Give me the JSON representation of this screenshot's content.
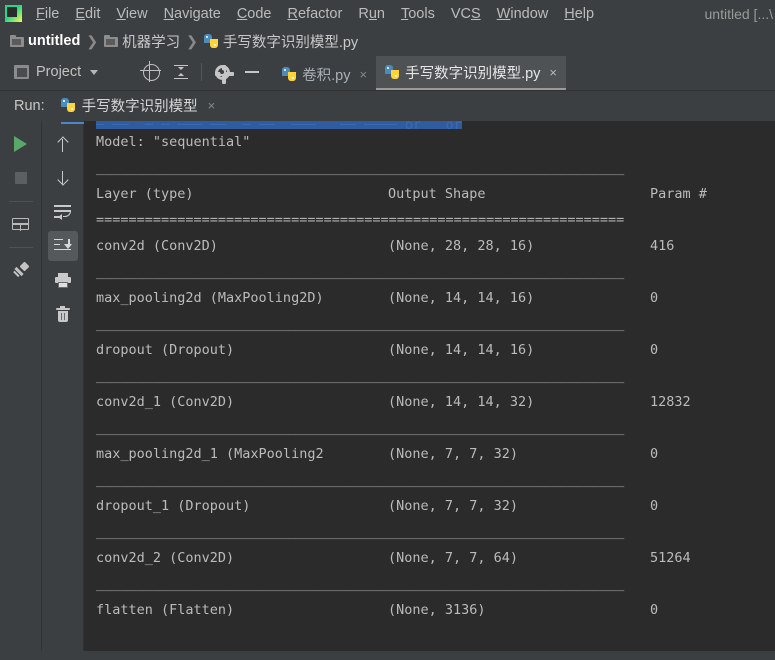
{
  "window": {
    "title": "untitled [...\\"
  },
  "menubar": {
    "items": [
      {
        "label": "File",
        "mnemonic": "F"
      },
      {
        "label": "Edit",
        "mnemonic": "E"
      },
      {
        "label": "View",
        "mnemonic": "V"
      },
      {
        "label": "Navigate",
        "mnemonic": "N"
      },
      {
        "label": "Code",
        "mnemonic": "C"
      },
      {
        "label": "Refactor",
        "mnemonic": "R"
      },
      {
        "label": "Run",
        "mnemonic": "u"
      },
      {
        "label": "Tools",
        "mnemonic": "T"
      },
      {
        "label": "VCS",
        "mnemonic": "S"
      },
      {
        "label": "Window",
        "mnemonic": "W"
      },
      {
        "label": "Help",
        "mnemonic": "H"
      }
    ]
  },
  "breadcrumb": {
    "root": "untitled",
    "folder": "机器学习",
    "file": "手写数字识别模型.py",
    "separator": "❯"
  },
  "toolbar": {
    "project_label": "Project",
    "buttons": [
      {
        "name": "locate-icon",
        "title": "Select Opened File"
      },
      {
        "name": "collapse-all-icon",
        "title": "Collapse All"
      },
      {
        "name": "gear-icon",
        "title": "Settings"
      },
      {
        "name": "minimize-icon",
        "title": "Hide"
      }
    ]
  },
  "editor_tabs": [
    {
      "label": "卷积.py",
      "active": false,
      "close": "×"
    },
    {
      "label": "手写数字识别模型.py",
      "active": true,
      "close": "×"
    }
  ],
  "run_panel": {
    "label": "Run:",
    "config_name": "手写数字识别模型",
    "close": "×",
    "left_buttons": [
      {
        "name": "rerun-button",
        "icon": "run-icon"
      },
      {
        "name": "stop-button",
        "icon": "stop-icon"
      },
      {
        "name": "restore-layout-button",
        "icon": "layout-icon"
      },
      {
        "name": "pin-tab-button",
        "icon": "pin-icon"
      }
    ],
    "right_buttons": [
      {
        "name": "up-the-stack-trace-button",
        "icon": "arrow-up-icon"
      },
      {
        "name": "down-the-stack-trace-button",
        "icon": "arrow-down-icon"
      },
      {
        "name": "soft-wrap-button",
        "icon": "soft-wrap-icon",
        "active": false
      },
      {
        "name": "scroll-to-end-button",
        "icon": "scroll-to-end-icon",
        "active": true
      },
      {
        "name": "print-button",
        "icon": "print-icon"
      },
      {
        "name": "clear-all-button",
        "icon": "trash-icon"
      }
    ]
  },
  "console": {
    "clipped_top_line": "─ ──  ─ ─ ─── ──  ─ ──  ───   ── ──── or   or",
    "model_title": "Model: \"sequential\"",
    "dash_rule": "_________________________________________________________________",
    "equals_rule": "=================================================================",
    "headers": {
      "layer": "Layer (type)",
      "shape": "Output Shape",
      "param": "Param #"
    },
    "rows": [
      {
        "layer": "conv2d (Conv2D)",
        "shape": "(None, 28, 28, 16)",
        "param": "416"
      },
      {
        "layer": "max_pooling2d (MaxPooling2D)",
        "shape": "(None, 14, 14, 16)",
        "param": "0"
      },
      {
        "layer": "dropout (Dropout)",
        "shape": "(None, 14, 14, 16)",
        "param": "0"
      },
      {
        "layer": "conv2d_1 (Conv2D)",
        "shape": "(None, 14, 14, 32)",
        "param": "12832"
      },
      {
        "layer": "max_pooling2d_1 (MaxPooling2",
        "shape": "(None, 7, 7, 32)",
        "param": "0"
      },
      {
        "layer": "dropout_1 (Dropout)",
        "shape": "(None, 7, 7, 32)",
        "param": "0"
      },
      {
        "layer": "conv2d_2 (Conv2D)",
        "shape": "(None, 7, 7, 64)",
        "param": "51264"
      },
      {
        "layer": "flatten (Flatten)",
        "shape": "(None, 3136)",
        "param": "0"
      }
    ]
  },
  "colors": {
    "chrome": "#3c3f41",
    "console_bg": "#2b2b2b",
    "accent_blue": "#4a88c7",
    "run_green": "#59a869",
    "error_red": "#cc5555",
    "tab_active": "#4e5254"
  }
}
